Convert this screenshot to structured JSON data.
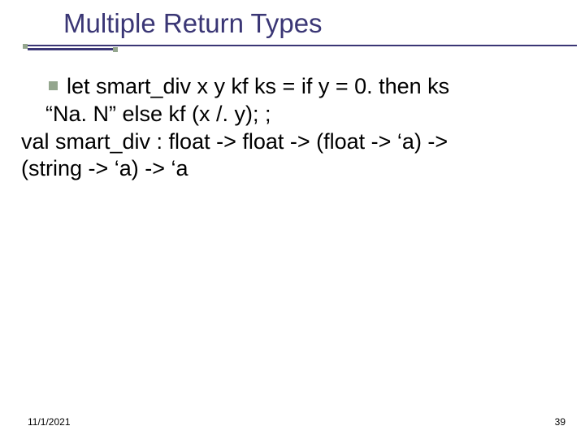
{
  "title": "Multiple Return Types",
  "body": {
    "line1": "let smart_div x y kf ks = if y = 0. then ks",
    "line2": "“Na. N” else kf (x /. y); ;",
    "line3": "val smart_div : float -> float -> (float -> ‘a) ->",
    "line4": "(string -> ‘a) -> ‘a"
  },
  "footer": {
    "date": "11/1/2021",
    "page": "39"
  }
}
